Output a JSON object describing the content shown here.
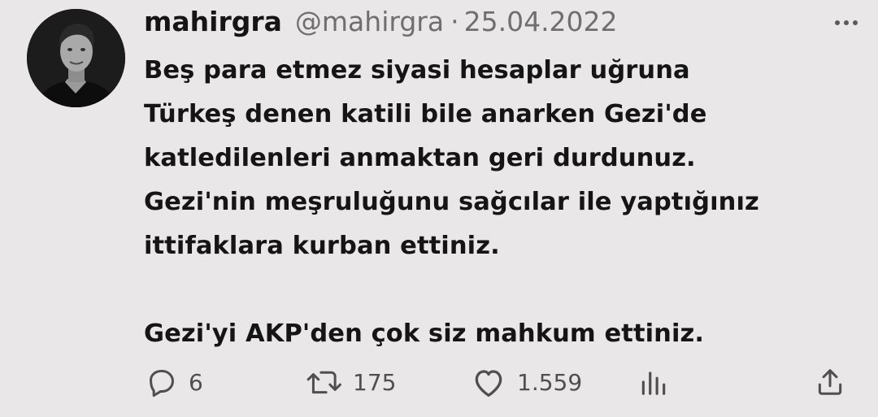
{
  "tweet": {
    "author_name": "mahirgra",
    "handle": "@mahirgra",
    "separator": "·",
    "date": "25.04.2022",
    "paragraph1_lines": [
      "Beş para etmez siyasi hesaplar uğruna",
      "Türkeş denen katili bile anarken Gezi'de",
      "katledilenleri anmaktan geri durdunuz.",
      "Gezi'nin meşruluğunu sağcılar ile yaptığınız",
      "ittifaklara kurban ettiniz."
    ],
    "paragraph2": "Gezi'yi AKP'den çok siz mahkum ettiniz."
  },
  "actions": {
    "reply_count": "6",
    "retweet_count": "175",
    "like_count": "1.559"
  },
  "icons": {
    "more": "more-options-icon",
    "reply": "reply-icon",
    "retweet": "retweet-icon",
    "like": "heart-icon",
    "views": "analytics-icon",
    "share": "share-icon"
  },
  "colors": {
    "background": "#e9e7e7",
    "text": "#151515",
    "secondary_text": "#6f6f6f",
    "icon": "#4f4f4f"
  }
}
